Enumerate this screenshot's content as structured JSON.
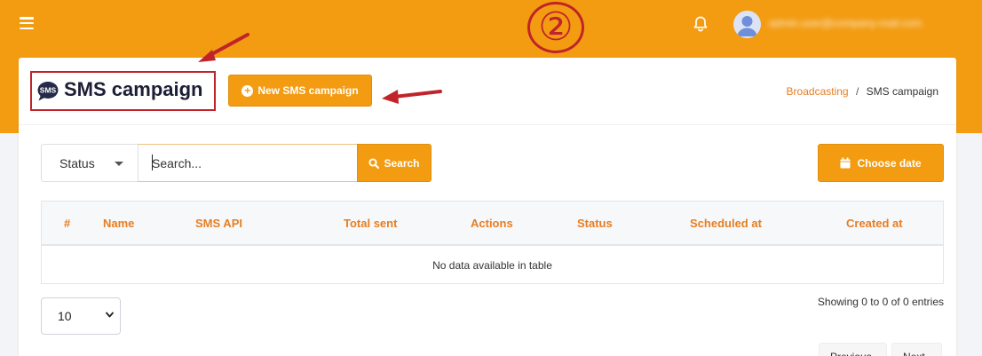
{
  "topbar": {
    "menu_icon": "hamburger-icon",
    "notification_icon": "bell-icon",
    "avatar_icon": "user-avatar-icon",
    "username": "admin.user@company-mail.com",
    "bg_color": "#f39c12"
  },
  "annotation": {
    "step_marker": "②",
    "color": "#c0242a"
  },
  "header": {
    "title": "SMS campaign",
    "title_icon": "sms-speech-bubble-icon",
    "title_icon_text": "SMS",
    "new_button_label": "New SMS campaign",
    "new_button_icon": "plus-circle-icon",
    "breadcrumb": {
      "parent": "Broadcasting",
      "separator": "/",
      "current": "SMS campaign"
    }
  },
  "filters": {
    "status_label": "Status",
    "search_placeholder": "Search...",
    "search_value": "",
    "search_button": "Search",
    "search_icon": "magnifier-icon",
    "date_button": "Choose date",
    "date_icon": "calendar-icon"
  },
  "table": {
    "columns": [
      "#",
      "Name",
      "SMS API",
      "Total sent",
      "Actions",
      "Status",
      "Scheduled at",
      "Created at"
    ],
    "empty_message": "No data available in table"
  },
  "footer": {
    "showing": "Showing 0 to 0 of 0 entries",
    "page_size": "10",
    "page_size_options": [
      "10"
    ],
    "prev_label": "Previous",
    "next_label": "Next"
  },
  "colors": {
    "accent": "#f39c12",
    "link": "#e67e22",
    "title": "#1d1d35"
  }
}
